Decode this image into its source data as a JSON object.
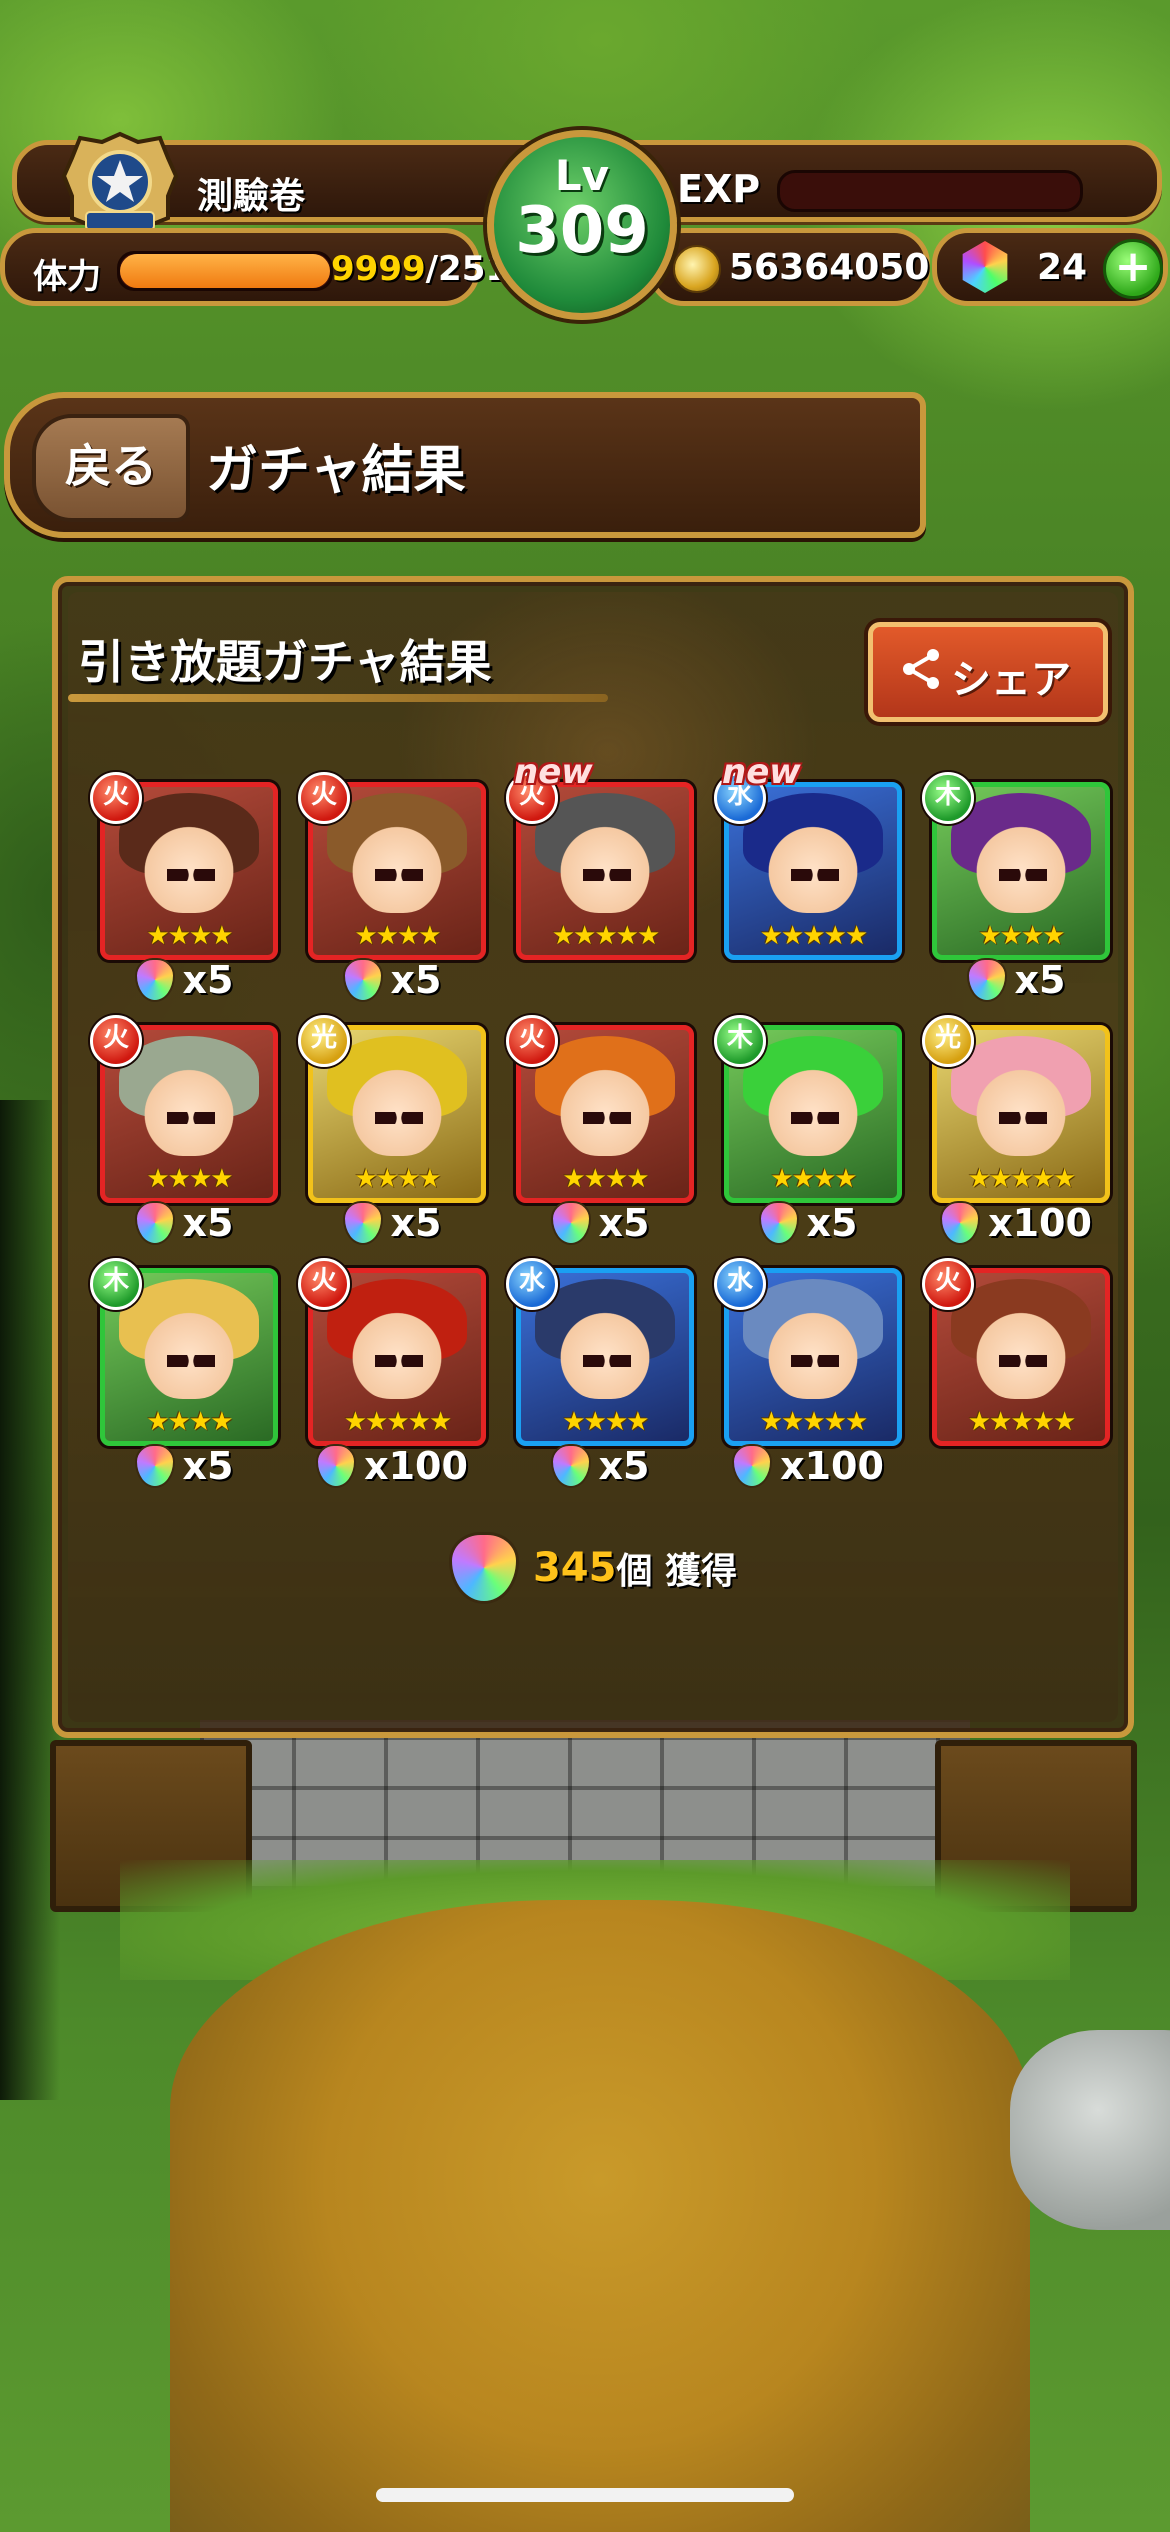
{
  "status_bar": {
    "player_name": "測驗卷",
    "level_label": "Lv",
    "level": "309",
    "exp_label": "EXP",
    "stamina_label": "体力",
    "stamina_current": "9999",
    "stamina_max": "/251",
    "stamina_fill_fraction": 1.0,
    "coins": "56364050",
    "orbs": "24",
    "add_orbs_symbol": "+"
  },
  "header": {
    "back_label": "戻る",
    "title": "ガチャ結果"
  },
  "results": {
    "title": "引き放題ガチャ結果",
    "share_label": "シェア",
    "new_tag": "new",
    "items": [
      {
        "attribute": "fire",
        "stars": 4,
        "reward": "x5",
        "is_new": false,
        "hair_color": "#5a2a1a"
      },
      {
        "attribute": "fire",
        "stars": 4,
        "reward": "x5",
        "is_new": false,
        "hair_color": "#8a5a2a"
      },
      {
        "attribute": "fire",
        "stars": 5,
        "reward": "",
        "is_new": true,
        "hair_color": "#555555"
      },
      {
        "attribute": "water",
        "stars": 5,
        "reward": "",
        "is_new": true,
        "hair_color": "#1a2a8a"
      },
      {
        "attribute": "wood",
        "stars": 4,
        "reward": "x5",
        "is_new": false,
        "hair_color": "#6a2a8a"
      },
      {
        "attribute": "fire",
        "stars": 4,
        "reward": "x5",
        "is_new": false,
        "hair_color": "#9aa890"
      },
      {
        "attribute": "light",
        "stars": 4,
        "reward": "x5",
        "is_new": false,
        "hair_color": "#e0c020"
      },
      {
        "attribute": "fire",
        "stars": 4,
        "reward": "x5",
        "is_new": false,
        "hair_color": "#e0701a"
      },
      {
        "attribute": "wood",
        "stars": 4,
        "reward": "x5",
        "is_new": false,
        "hair_color": "#3ad03a"
      },
      {
        "attribute": "light",
        "stars": 5,
        "reward": "x100",
        "is_new": false,
        "hair_color": "#f0a0b0"
      },
      {
        "attribute": "wood",
        "stars": 4,
        "reward": "x5",
        "is_new": false,
        "hair_color": "#e8c050"
      },
      {
        "attribute": "fire",
        "stars": 5,
        "reward": "x100",
        "is_new": false,
        "hair_color": "#c02010"
      },
      {
        "attribute": "water",
        "stars": 4,
        "reward": "x5",
        "is_new": false,
        "hair_color": "#2a3a6a"
      },
      {
        "attribute": "water",
        "stars": 5,
        "reward": "x100",
        "is_new": false,
        "hair_color": "#6a8ac0"
      },
      {
        "attribute": "fire",
        "stars": 5,
        "reward": "",
        "is_new": false,
        "hair_color": "#8a3a20"
      }
    ],
    "total_count": "345",
    "total_unit": "個 獲得"
  },
  "icons": {
    "badge": "police-badge-icon",
    "coin": "coin-icon",
    "orb": "orb-icon",
    "share": "share-icon",
    "fruit": "luck-fruit-icon"
  },
  "colors": {
    "frame_gold": "#c9983c",
    "share_button": "#e25a2a",
    "total_count": "#ffc21a",
    "fire": "#e42424",
    "water": "#1aa0f2",
    "wood": "#2fc63a",
    "light": "#f2c21a"
  }
}
